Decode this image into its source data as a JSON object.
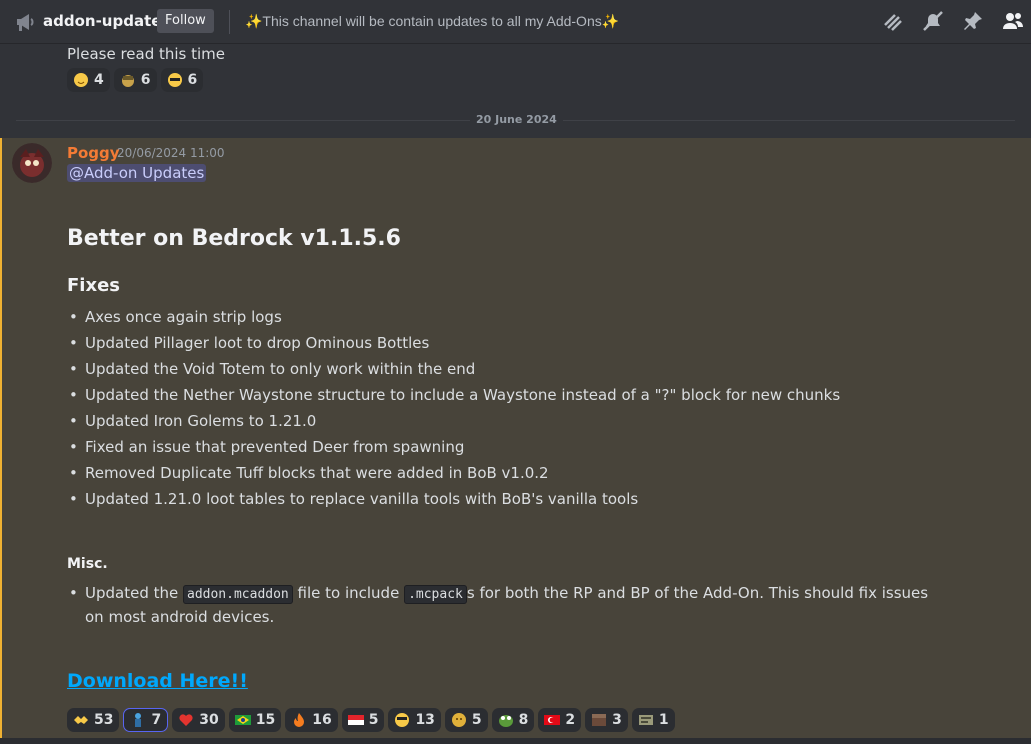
{
  "header": {
    "channel_name": "addon-updates",
    "follow_label": "Follow",
    "topic": "✨This channel will be contain updates to all my Add-Ons✨",
    "icons": [
      "threads-icon",
      "mute-icon",
      "pin-icon",
      "members-icon"
    ]
  },
  "previous_message": {
    "text": "Please read this time",
    "reactions": [
      {
        "emoji": "smile-emoji",
        "count": "4"
      },
      {
        "emoji": "helmet-emoji",
        "count": "6"
      },
      {
        "emoji": "sunglasses-emoji",
        "count": "6"
      }
    ]
  },
  "date_divider": "20 June 2024",
  "message": {
    "author": "Poggy",
    "timestamp": "20/06/2024 11:00",
    "mention": "@Add-on Updates",
    "title": "Better on Bedrock v1.1.5.6",
    "fixes_heading": "Fixes",
    "fixes": [
      "Axes once again strip logs",
      "Updated Pillager loot to drop Ominous Bottles",
      "Updated the Void Totem to only work within the end",
      "Updated the Nether Waystone structure to include a Waystone instead of a \"?\" block for new chunks",
      "Updated Iron Golems to 1.21.0",
      "Fixed an issue that prevented Deer from spawning",
      "Removed Duplicate Tuff blocks that were added in BoB v1.0.2",
      "Updated 1.21.0 loot tables to replace vanilla tools with BoB's vanilla tools"
    ],
    "misc_heading": "Misc.",
    "misc": {
      "before": "Updated the ",
      "code1": "addon.mcaddon",
      "middle": " file to include ",
      "code2": ".mcpack",
      "after": "s for both the RP and BP of the Add-On. This should fix issues on most android devices."
    },
    "download_label": "Download Here!!",
    "reactions": [
      {
        "emoji": "handshake-emoji",
        "count": "53"
      },
      {
        "emoji": "blue-figure-emoji",
        "count": "7"
      },
      {
        "emoji": "heart-emoji",
        "count": "30"
      },
      {
        "emoji": "brazil-flag-emoji",
        "count": "15"
      },
      {
        "emoji": "fire-emoji",
        "count": "16"
      },
      {
        "emoji": "indonesia-flag-emoji",
        "count": "5"
      },
      {
        "emoji": "cool-face-emoji",
        "count": "13"
      },
      {
        "emoji": "coin-face-emoji",
        "count": "5"
      },
      {
        "emoji": "poggers-emoji",
        "count": "8"
      },
      {
        "emoji": "turkey-flag-emoji",
        "count": "2"
      },
      {
        "emoji": "block-emoji",
        "count": "3"
      },
      {
        "emoji": "sign-emoji",
        "count": "1"
      }
    ]
  },
  "colors": {
    "background": "#313338",
    "highlight": "#48443a",
    "author": "#f47b35",
    "link": "#00a8fc"
  }
}
